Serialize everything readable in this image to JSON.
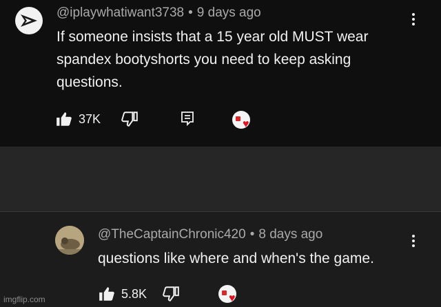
{
  "comment": {
    "author": "@iplaywhatiwant3738",
    "time": "9 days ago",
    "text": "If someone insists that a 15 year old MUST wear spandex bootyshorts you need to keep asking questions.",
    "likes": "37K"
  },
  "reply": {
    "author": "@TheCaptainChronic420",
    "time": "8 days ago",
    "text": "questions like where and when's the game.",
    "likes": "5.8K"
  },
  "separator": "•",
  "watermark": "imgflip.com",
  "icons": {
    "like": "thumbs-up-icon",
    "dislike": "thumbs-down-icon",
    "reply": "reply-icon",
    "more": "kebab-menu-icon",
    "creator_heart": "creator-heart-icon"
  },
  "colors": {
    "heart": "#e0101f",
    "meta_text": "#aaaaaa",
    "primary_text": "#f1f1f1"
  }
}
